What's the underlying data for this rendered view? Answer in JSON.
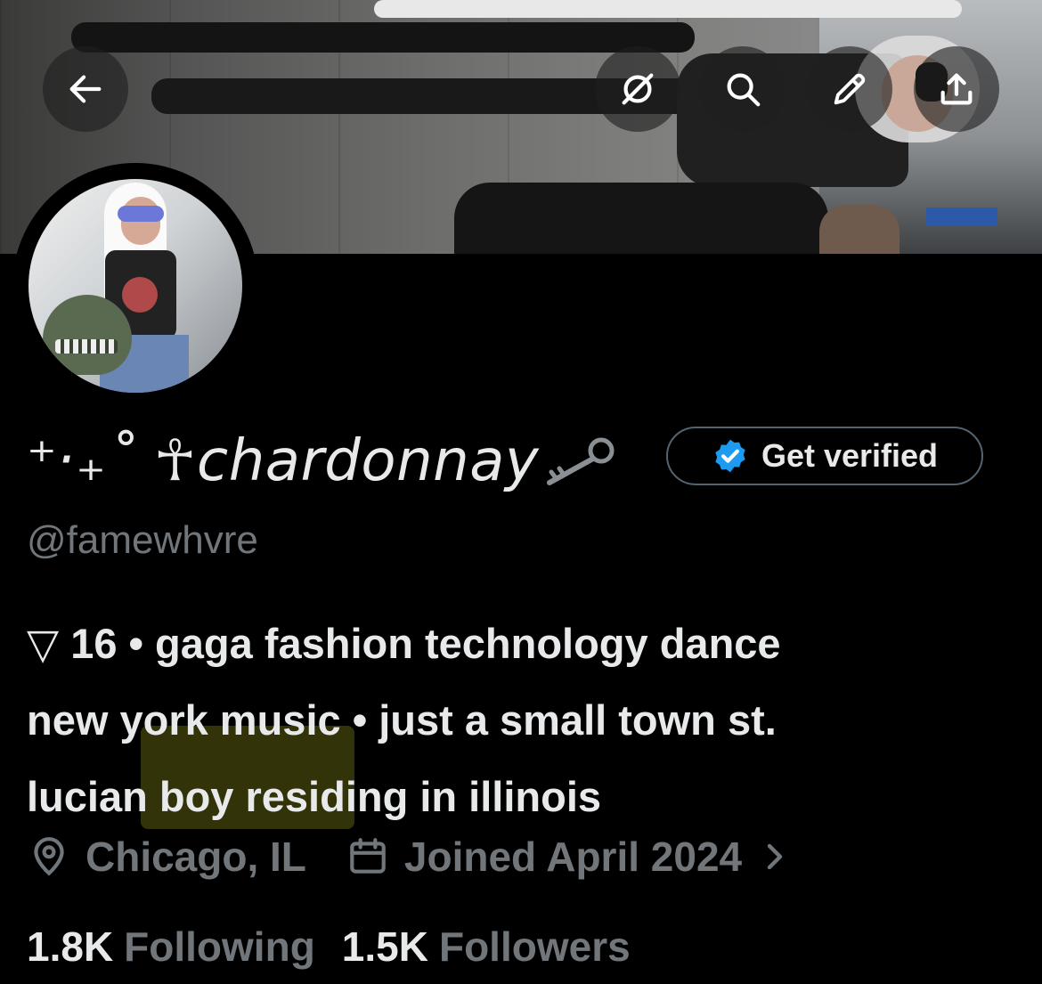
{
  "header": {
    "back_icon": "arrow-left-icon",
    "actions": [
      "grok-icon",
      "search-icon",
      "edit-icon",
      "share-icon"
    ]
  },
  "profile": {
    "display_name": "⁺‧₊˚ ☥chardonnay",
    "name_emoji": "old-key-icon",
    "handle": "@famewhvre",
    "get_verified_label": "Get verified",
    "bio_lines": [
      "▽ 16 • gaga fashion technology dance",
      "new york music • just a small town st.",
      "lucian boy residing in illinois"
    ],
    "location": "Chicago, IL",
    "joined": "Joined April 2024",
    "following_count": "1.8K",
    "following_label": "Following",
    "followers_count": "1.5K",
    "followers_label": "Followers"
  },
  "colors": {
    "background": "#000000",
    "primary_text": "#e7e9ea",
    "secondary_text": "#71767b",
    "verified_blue": "#1d9bf0",
    "highlight": "#e6e828"
  }
}
